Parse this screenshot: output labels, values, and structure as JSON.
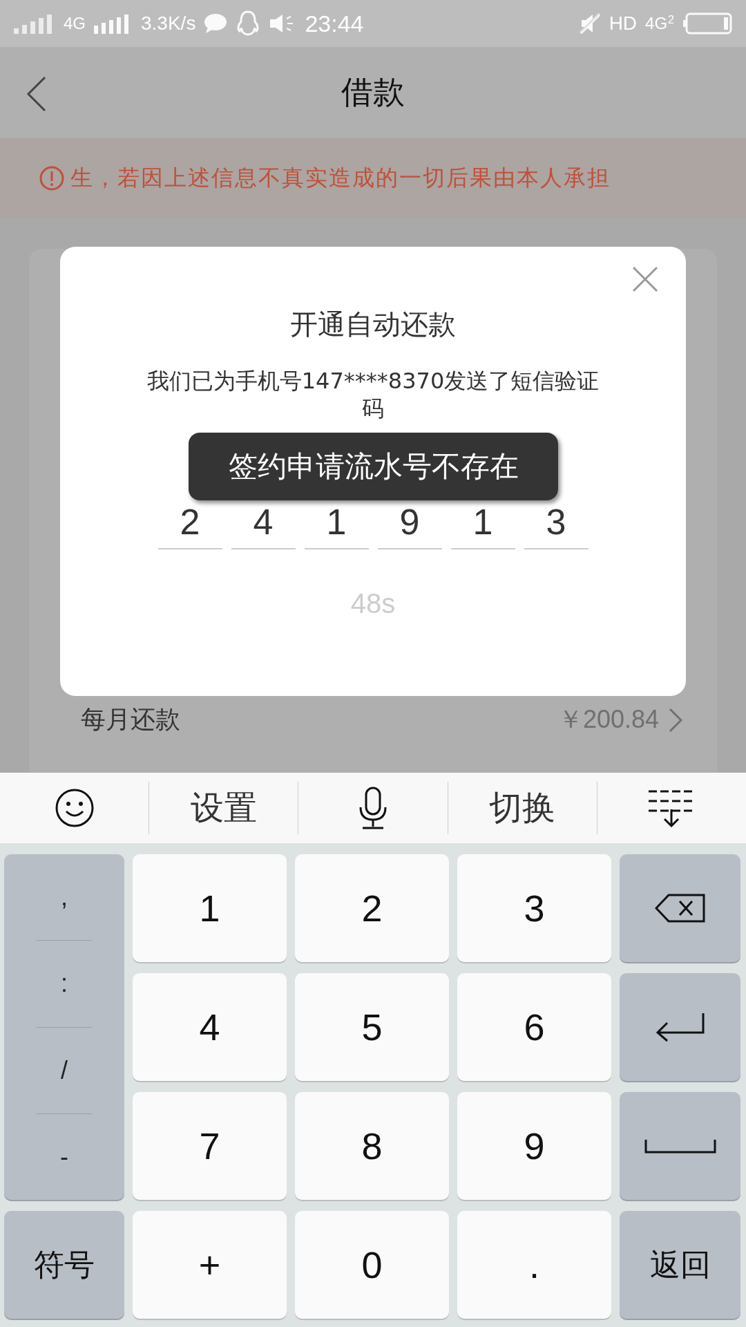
{
  "status_bar": {
    "network": "4G",
    "speed": "3.3K/s",
    "time": "23:44",
    "hd": "HD",
    "network_right": "4G",
    "sim": "2"
  },
  "header": {
    "title": "借款"
  },
  "notice": {
    "text": "生，若因上述信息不真实造成的一切后果由本人承担"
  },
  "dialog": {
    "title": "开通自动还款",
    "message": "我们已为手机号147****8370发送了短信验证码",
    "code": [
      "2",
      "4",
      "1",
      "9",
      "1",
      "3"
    ],
    "timer": "48s"
  },
  "toast": {
    "text": "签约申请流水号不存在"
  },
  "monthly": {
    "label": "每月还款",
    "value": "￥200.84"
  },
  "keyboard_toolbar": [
    {
      "kind": "emoji"
    },
    {
      "kind": "text",
      "label": "设置"
    },
    {
      "kind": "mic"
    },
    {
      "kind": "text",
      "label": "切换"
    },
    {
      "kind": "collapse"
    }
  ],
  "symbols": [
    ",",
    ":",
    "/",
    "-"
  ],
  "keys": [
    {
      "kind": "digit",
      "label": "1"
    },
    {
      "kind": "digit",
      "label": "2"
    },
    {
      "kind": "digit",
      "label": "3"
    },
    {
      "kind": "backspace"
    },
    {
      "kind": "digit",
      "label": "4"
    },
    {
      "kind": "digit",
      "label": "5"
    },
    {
      "kind": "digit",
      "label": "6"
    },
    {
      "kind": "enter"
    },
    {
      "kind": "digit",
      "label": "7"
    },
    {
      "kind": "digit",
      "label": "8"
    },
    {
      "kind": "digit",
      "label": "9"
    },
    {
      "kind": "space"
    },
    {
      "kind": "function",
      "label": "符号"
    },
    {
      "kind": "digit",
      "label": "+"
    },
    {
      "kind": "digit",
      "label": "0"
    },
    {
      "kind": "digit",
      "label": "."
    },
    {
      "kind": "function",
      "label": "返回"
    }
  ]
}
